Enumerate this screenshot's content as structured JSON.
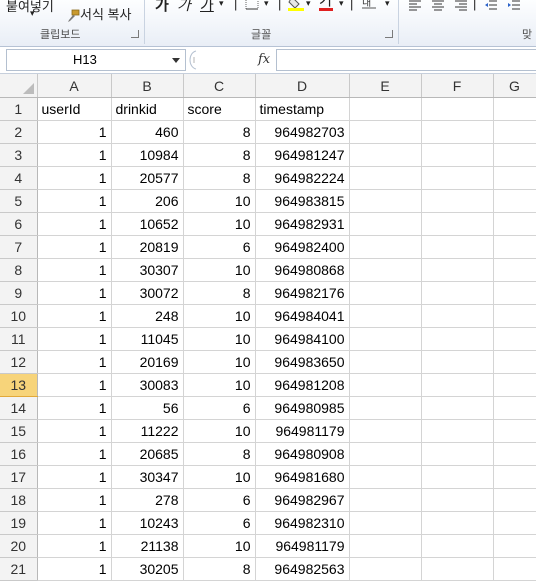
{
  "ribbon": {
    "paste_label": "붙여넣기",
    "format_painter_label": "서식 복사",
    "clipboard_group": "클립보드",
    "font_group": "글꼴",
    "para_group": "맞"
  },
  "formula_bar": {
    "name_box": "H13",
    "fx": "fx",
    "content": ""
  },
  "columns": [
    "A",
    "B",
    "C",
    "D",
    "E",
    "F",
    "G"
  ],
  "selected_row": 13,
  "rows": [
    {
      "n": "1",
      "a": "userId",
      "b": "drinkid",
      "c": "score",
      "d": "timestamp"
    },
    {
      "n": "2",
      "a": "1",
      "b": "460",
      "c": "8",
      "d": "964982703"
    },
    {
      "n": "3",
      "a": "1",
      "b": "10984",
      "c": "8",
      "d": "964981247"
    },
    {
      "n": "4",
      "a": "1",
      "b": "20577",
      "c": "8",
      "d": "964982224"
    },
    {
      "n": "5",
      "a": "1",
      "b": "206",
      "c": "10",
      "d": "964983815"
    },
    {
      "n": "6",
      "a": "1",
      "b": "10652",
      "c": "10",
      "d": "964982931"
    },
    {
      "n": "7",
      "a": "1",
      "b": "20819",
      "c": "6",
      "d": "964982400"
    },
    {
      "n": "8",
      "a": "1",
      "b": "30307",
      "c": "10",
      "d": "964980868"
    },
    {
      "n": "9",
      "a": "1",
      "b": "30072",
      "c": "8",
      "d": "964982176"
    },
    {
      "n": "10",
      "a": "1",
      "b": "248",
      "c": "10",
      "d": "964984041"
    },
    {
      "n": "11",
      "a": "1",
      "b": "11045",
      "c": "10",
      "d": "964984100"
    },
    {
      "n": "12",
      "a": "1",
      "b": "20169",
      "c": "10",
      "d": "964983650"
    },
    {
      "n": "13",
      "a": "1",
      "b": "30083",
      "c": "10",
      "d": "964981208"
    },
    {
      "n": "14",
      "a": "1",
      "b": "56",
      "c": "6",
      "d": "964980985"
    },
    {
      "n": "15",
      "a": "1",
      "b": "11222",
      "c": "10",
      "d": "964981179"
    },
    {
      "n": "16",
      "a": "1",
      "b": "20685",
      "c": "8",
      "d": "964980908"
    },
    {
      "n": "17",
      "a": "1",
      "b": "30347",
      "c": "10",
      "d": "964981680"
    },
    {
      "n": "18",
      "a": "1",
      "b": "278",
      "c": "6",
      "d": "964982967"
    },
    {
      "n": "19",
      "a": "1",
      "b": "10243",
      "c": "6",
      "d": "964982310"
    },
    {
      "n": "20",
      "a": "1",
      "b": "21138",
      "c": "10",
      "d": "964981179"
    },
    {
      "n": "21",
      "a": "1",
      "b": "30205",
      "c": "8",
      "d": "964982563"
    }
  ]
}
